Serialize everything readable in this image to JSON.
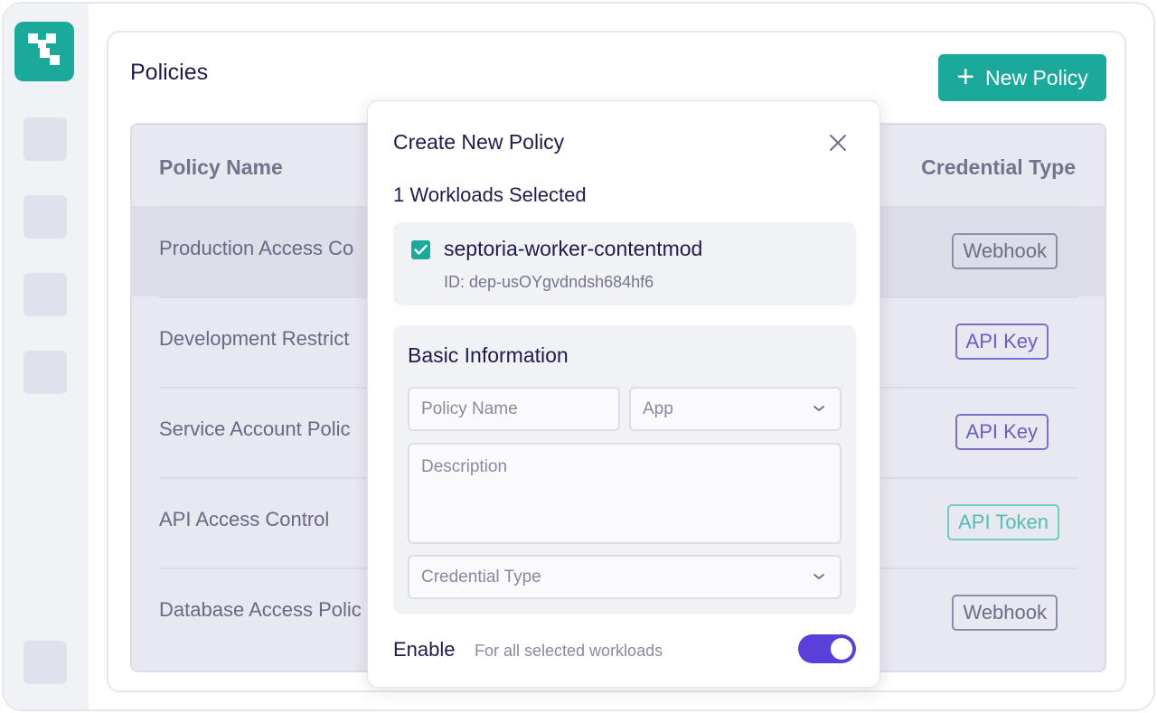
{
  "page": {
    "title": "Policies",
    "new_button_label": "New Policy"
  },
  "table": {
    "columns": [
      "Policy Name",
      "Credential Type"
    ],
    "rows": [
      {
        "name": "Production Access Co",
        "credential_type": "Webhook"
      },
      {
        "name": "Development Restrict",
        "credential_type": "API Key"
      },
      {
        "name": "Service Account Polic",
        "credential_type": "API Key"
      },
      {
        "name": "API Access Control",
        "credential_type": "API Token"
      },
      {
        "name": "Database Access Polic",
        "credential_type": "Webhook"
      }
    ]
  },
  "modal": {
    "title": "Create New Policy",
    "selected_count_label": "1 Workloads Selected",
    "workload": {
      "name": "septoria-worker-contentmod",
      "id": "ID: dep-usOYgvdndsh684hf6",
      "checked": true
    },
    "basic_info": {
      "title": "Basic Information",
      "policy_name_placeholder": "Policy Name",
      "app_placeholder": "App",
      "description_placeholder": "Description",
      "credential_type_placeholder": "Credential Type"
    },
    "enable": {
      "label": "Enable",
      "description": "For all selected workloads",
      "on": true
    }
  },
  "colors": {
    "brand": "#1aa99a",
    "toggle_on": "#5a3fd8",
    "badge_webhook": "#8e8ca6",
    "badge_api_key": "#7b6fd0",
    "badge_api_token": "#6fcdc3"
  }
}
